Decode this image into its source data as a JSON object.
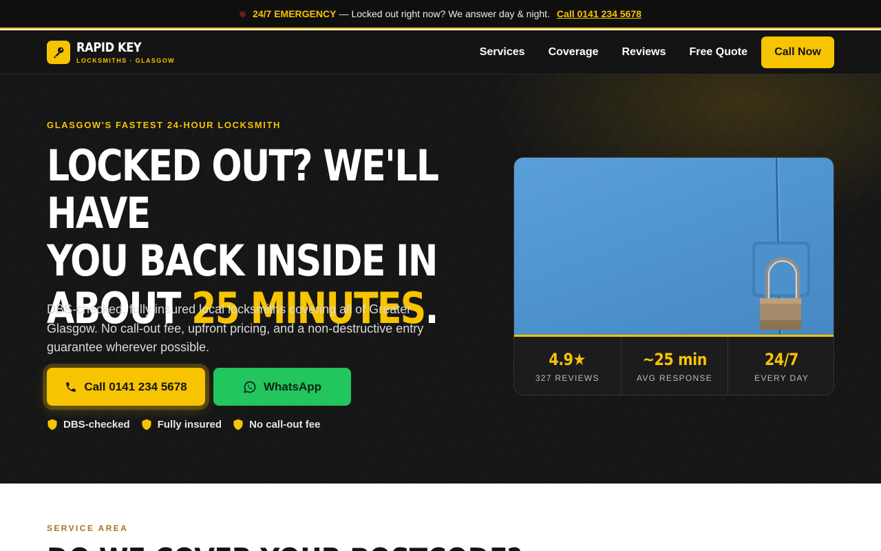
{
  "topbar": {
    "emergency": "24/7 EMERGENCY",
    "dash": "—",
    "message": "Locked out right now? We answer day & night.",
    "call_link": "Call 0141 234 5678"
  },
  "brand": {
    "name": "RAPID KEY",
    "tagline": "LOCKSMITHS · GLASGOW"
  },
  "nav": {
    "links": [
      "Services",
      "Coverage",
      "Reviews",
      "Free Quote"
    ],
    "cta": "Call Now"
  },
  "hero": {
    "eyebrow": "GLASGOW'S FASTEST 24-HOUR LOCKSMITH",
    "headline_lines": [
      "LOCKED OUT? WE'LL HAVE",
      "YOU BACK INSIDE IN"
    ],
    "headline_last_prefix": "ABOUT ",
    "headline_highlight": "25 MINUTES",
    "headline_suffix": ".",
    "lead": "DBS-checked, fully insured local locksmiths covering all of Greater Glasgow. No call-out fee, upfront pricing, and a non-destructive entry guarantee wherever possible.",
    "call_button": "Call 0141 234 5678",
    "whatsapp_button": "WhatsApp",
    "badges": [
      "DBS-checked",
      "Fully insured",
      "No call-out fee"
    ]
  },
  "card": {
    "stats": [
      {
        "value": "4.9★",
        "label": "327 REVIEWS"
      },
      {
        "value": "~25 min",
        "label": "AVG RESPONSE"
      },
      {
        "value": "24/7",
        "label": "EVERY DAY"
      }
    ]
  },
  "service_area": {
    "eyebrow": "SERVICE AREA",
    "title": "DO WE COVER YOUR POSTCODE?"
  },
  "colors": {
    "accent": "#f6c400",
    "dark": "#161617",
    "whatsapp": "#22c55e"
  },
  "icons": [
    "key-icon",
    "phone-icon",
    "whatsapp-icon",
    "shield-icon"
  ]
}
